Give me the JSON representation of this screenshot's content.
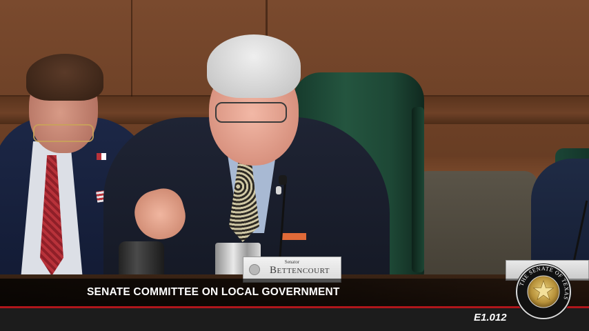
{
  "broadcast": {
    "lower_third_title": "SENATE COMMITTEE ON LOCAL GOVERNMENT",
    "event_code": "E1.012"
  },
  "nameplate": {
    "title": "Senator",
    "name": "Bettencourt"
  },
  "seal": {
    "text": "THE SENATE OF TEXAS",
    "icon": "texas-senate-seal-icon"
  },
  "colors": {
    "accent_red": "#b0161b",
    "bar_dark": "#1c1c1c",
    "text_white": "#ffffff"
  }
}
